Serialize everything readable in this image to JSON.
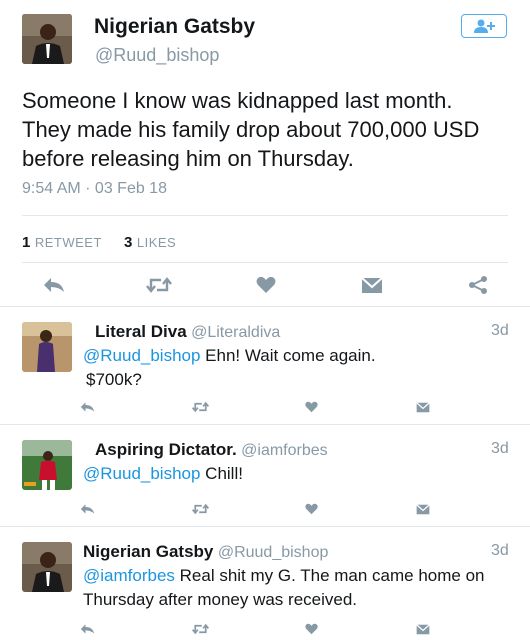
{
  "main_tweet": {
    "name": "Nigerian Gatsby",
    "handle": "@Ruud_bishop",
    "text_lines": [
      "Someone I know was kidnapped last month.",
      "They made his family drop about 700,000 USD",
      "before releasing him on Thursday."
    ],
    "timestamp": "9:54 AM · 03 Feb 18",
    "retweets_count": "1",
    "retweets_label": "RETWEET",
    "likes_count": "3",
    "likes_label": "LIKES"
  },
  "replies": [
    {
      "name": "Literal Diva",
      "handle": "@Literaldiva",
      "time": "3d",
      "mention": "@Ruud_bishop",
      "text_after_mention": " Ehn! Wait come again.",
      "text_line2": "$700k?"
    },
    {
      "name": "Aspiring Dictator.",
      "handle": "@iamforbes",
      "time": "3d",
      "mention": "@Ruud_bishop",
      "text_after_mention": " Chill!",
      "text_line2": ""
    },
    {
      "name": "Nigerian Gatsby",
      "handle": "@Ruud_bishop",
      "time": "3d",
      "mention": "@iamforbes",
      "text_after_mention": " Real shit my G. The man came home on",
      "text_line2": "Thursday after money was received."
    }
  ],
  "icons": {
    "follow": "add-user-icon",
    "reply": "reply-icon",
    "retweet": "retweet-icon",
    "like": "heart-icon",
    "dm": "envelope-icon",
    "share": "share-icon"
  },
  "colors": {
    "link": "#1b95e0",
    "accent": "#55acee",
    "muted": "#8899a6",
    "icon": "#8899a6",
    "text": "#14171a"
  }
}
